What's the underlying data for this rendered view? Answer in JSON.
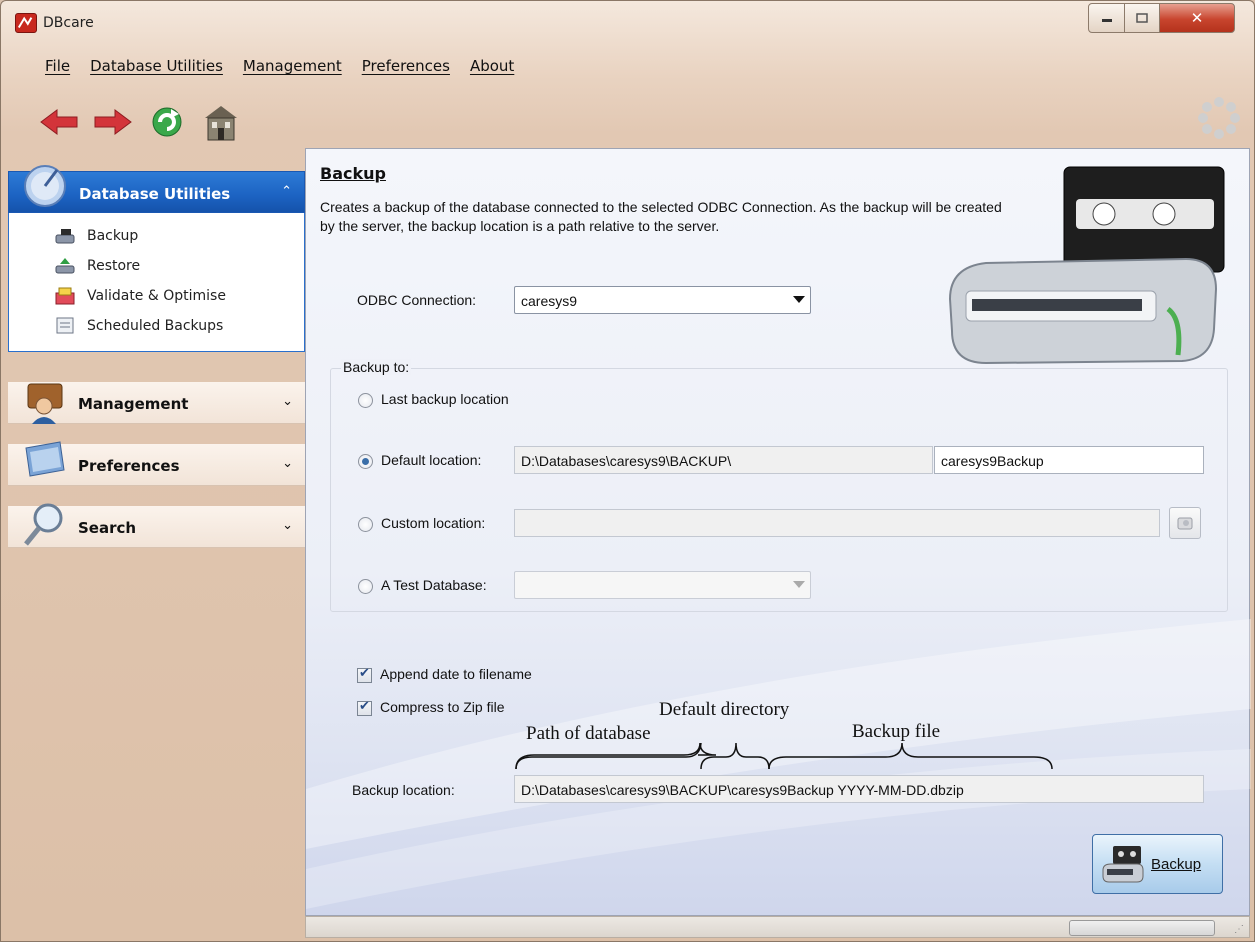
{
  "window": {
    "title": "DBcare"
  },
  "menu": [
    {
      "label": "File"
    },
    {
      "label": "Database Utilities"
    },
    {
      "label": "Management"
    },
    {
      "label": "Preferences"
    },
    {
      "label": "About"
    }
  ],
  "toolbar": {
    "icons": [
      "back-arrow-icon",
      "forward-arrow-icon",
      "refresh-icon",
      "home-building-icon"
    ]
  },
  "sidebar": {
    "groups": [
      {
        "label": "Database Utilities",
        "expanded": true,
        "items": [
          {
            "label": "Backup",
            "icon": "backup-drive-icon"
          },
          {
            "label": "Restore",
            "icon": "restore-icon"
          },
          {
            "label": "Validate & Optimise",
            "icon": "validate-icon"
          },
          {
            "label": "Scheduled Backups",
            "icon": "schedule-icon"
          }
        ]
      },
      {
        "label": "Management",
        "expanded": false
      },
      {
        "label": "Preferences",
        "expanded": false
      },
      {
        "label": "Search",
        "expanded": false
      }
    ]
  },
  "content": {
    "title": "Backup",
    "description": "Creates a backup of the database connected to the selected ODBC Connection. As the backup will be created by the server, the backup location is a path relative to the server.",
    "odbc_label": "ODBC Connection:",
    "odbc_value": "caresys9",
    "backup_to_label": "Backup to:",
    "options": {
      "last": "Last backup location",
      "default": "Default location:",
      "custom": "Custom location:",
      "test": "A Test Database:"
    },
    "default_path": "D:\\Databases\\caresys9\\BACKUP\\",
    "default_name": "caresys9Backup",
    "custom_path": "",
    "append_date_label": "Append date to filename",
    "compress_label": "Compress to Zip file",
    "annotations": {
      "path": "Path of database",
      "directory": "Default directory",
      "file": "Backup file"
    },
    "backup_location_label": "Backup location:",
    "backup_location_value": "D:\\Databases\\caresys9\\BACKUP\\caresys9Backup YYYY-MM-DD.dbzip",
    "backup_button": "Backup"
  },
  "colors": {
    "accent_blue": "#1c63c2",
    "close_red": "#c8452e"
  }
}
